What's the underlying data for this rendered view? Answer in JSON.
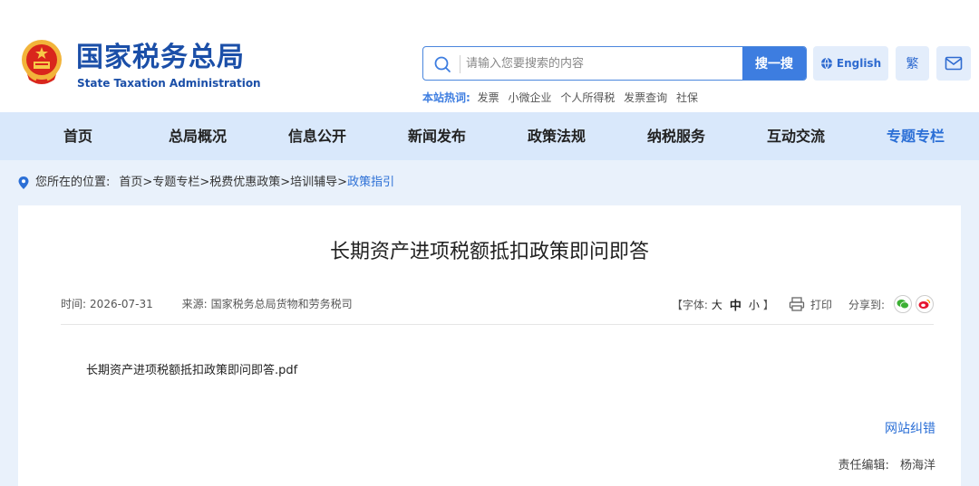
{
  "header": {
    "logo_cn": "国家税务总局",
    "logo_en": "State Taxation Administration",
    "search_placeholder": "请输入您要搜索的内容",
    "search_button": "搜一搜",
    "hot_label": "本站热词:",
    "hot_words": [
      "发票",
      "小微企业",
      "个人所得税",
      "发票查询",
      "社保"
    ],
    "english_label": "English",
    "traditional_label": "繁",
    "accent_color": "#3d7de0"
  },
  "nav": {
    "items": [
      "首页",
      "总局概况",
      "信息公开",
      "新闻发布",
      "政策法规",
      "纳税服务",
      "互动交流",
      "专题专栏"
    ],
    "active": "专题专栏"
  },
  "breadcrumb": {
    "label": "您所在的位置:",
    "items": [
      "首页",
      "专题专栏",
      "税费优惠政策",
      "培训辅导",
      "政策指引"
    ],
    "separator": ">"
  },
  "article": {
    "title": "长期资产进项税额抵扣政策即问即答",
    "time_label": "时间:",
    "time": "2026-07-31",
    "source_label": "来源:",
    "source": "国家税务总局货物和劳务税司",
    "font_label_open": "【字体:",
    "font_sizes": [
      "大",
      "中",
      "小"
    ],
    "font_label_close": "】",
    "print_label": "打印",
    "share_label": "分享到:",
    "attachment": "长期资产进项税额抵扣政策即问即答.pdf",
    "report_error": "网站纠错",
    "editor_label": "责任编辑:",
    "editor": "杨海洋"
  }
}
